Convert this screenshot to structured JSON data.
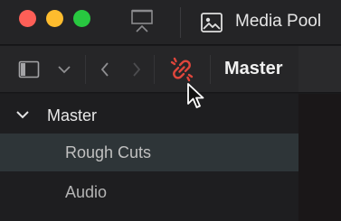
{
  "window": {
    "title": "Media Pool",
    "controls": [
      "close",
      "minimize",
      "zoom"
    ],
    "colors": {
      "close": "#fe5f57",
      "minimize": "#febc2e",
      "zoom": "#28c840"
    }
  },
  "titlebar": {
    "icons": [
      "monitor-icon",
      "media-pool-icon"
    ]
  },
  "toolbar": {
    "title": "Master",
    "icons": [
      "sidebar-toggle-icon",
      "chevron-down-icon",
      "back-icon",
      "forward-icon",
      "unlink-icon"
    ],
    "accent_color": "#e0463c"
  },
  "bins": {
    "root": {
      "label": "Master",
      "expanded": true
    },
    "items": [
      {
        "label": "Rough Cuts",
        "selected": true
      },
      {
        "label": "Audio",
        "selected": false
      }
    ]
  }
}
